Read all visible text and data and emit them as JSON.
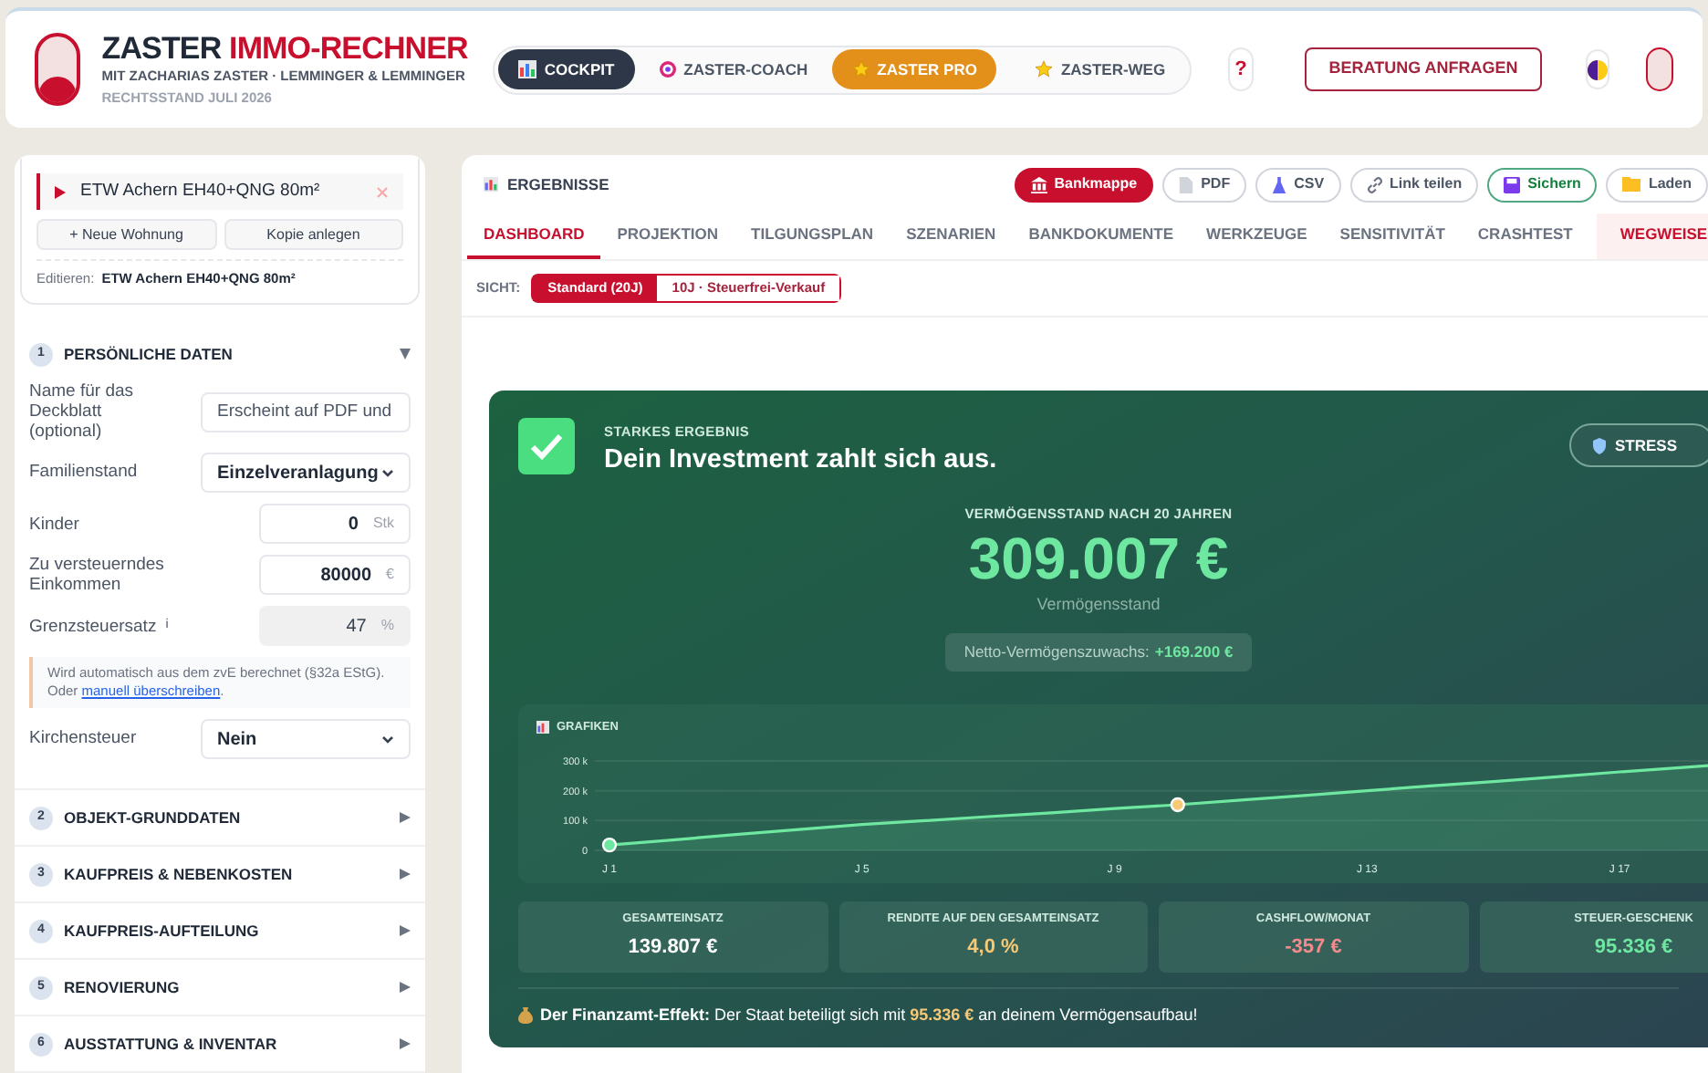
{
  "header": {
    "title": "ZASTER",
    "title_accent": "IMMO-RECHNER",
    "subtitle": "MIT ZACHARIAS ZASTER · LEMMINGER & LEMMINGER",
    "legal": "RECHTSSTAND JULI 2026",
    "nav": [
      {
        "label": "COCKPIT",
        "kind": "dash",
        "selected": true
      },
      {
        "label": "ZASTER-COACH",
        "kind": "coach",
        "selected": false
      },
      {
        "label": "ZASTER PRO",
        "kind": "pro",
        "selected": false
      },
      {
        "label": "ZASTER-WEG",
        "kind": "star",
        "selected": false
      }
    ],
    "help": "?",
    "consult": "BERATUNG ANFRAGEN"
  },
  "sidebar": {
    "property": "ETW Achern EH40+QNG 80m²",
    "new_button": "+ Neue Wohnung",
    "copy_button": "Kopie anlegen",
    "edit_label": "Editieren:",
    "edit_value": "ETW Achern EH40+QNG 80m²",
    "sections": [
      {
        "number": "1",
        "title": "PERSÖNLICHE DATEN",
        "expanded": true,
        "fields": [
          {
            "kind": "text",
            "label": "Name für das Deckblatt (optional)",
            "placeholder": "Erscheint auf PDF und"
          },
          {
            "kind": "select",
            "label": "Familienstand",
            "value": "Einzelveranlagung"
          },
          {
            "kind": "number",
            "label": "Kinder",
            "value": "0",
            "unit": "Stk"
          },
          {
            "kind": "number",
            "label": "Zu versteuerndes Einkommen",
            "value": "80000",
            "unit": "€"
          },
          {
            "kind": "readonly",
            "label": "Grenzsteuersatz",
            "info": "i",
            "value": "47",
            "unit": "%"
          },
          {
            "kind": "note",
            "text": "Wird automatisch aus dem zvE berechnet (§32a EStG). Oder ",
            "link": "manuell überschreiben",
            "tail": "."
          },
          {
            "kind": "select",
            "label": "Kirchensteuer",
            "value": "Nein"
          }
        ]
      },
      {
        "number": "2",
        "title": "OBJEKT-GRUNDDATEN",
        "expanded": false
      },
      {
        "number": "3",
        "title": "KAUFPREIS & NEBENKOSTEN",
        "expanded": false
      },
      {
        "number": "4",
        "title": "KAUFPREIS-AUFTEILUNG",
        "expanded": false
      },
      {
        "number": "5",
        "title": "RENOVIERUNG",
        "expanded": false
      },
      {
        "number": "6",
        "title": "AUSSTATTUNG & INVENTAR",
        "expanded": false
      }
    ]
  },
  "main": {
    "title": "ERGEBNISSE",
    "actions": [
      {
        "label": "Bankmappe",
        "kind": "primary"
      },
      {
        "label": "PDF",
        "kind": "pdf"
      },
      {
        "label": "CSV",
        "kind": "csv"
      },
      {
        "label": "Link teilen",
        "kind": "link"
      },
      {
        "label": "Sichern",
        "kind": "save"
      },
      {
        "label": "Laden",
        "kind": "load"
      }
    ],
    "tabs": [
      {
        "label": "DASHBOARD",
        "selected": true,
        "kind": "tab"
      },
      {
        "label": "PROJEKTION",
        "selected": false,
        "kind": "tab"
      },
      {
        "label": "TILGUNGSPLAN",
        "selected": false,
        "kind": "tab"
      },
      {
        "label": "SZENARIEN",
        "selected": false,
        "kind": "tab"
      },
      {
        "label": "BANKDOKUMENTE",
        "selected": false,
        "kind": "tab"
      },
      {
        "label": "WERKZEUGE",
        "selected": false,
        "kind": "tab"
      },
      {
        "label": "SENSITIVITÄT",
        "selected": false,
        "kind": "tab"
      },
      {
        "label": "CRASHTEST",
        "selected": false,
        "kind": "tab"
      },
      {
        "label": "WEGWEISE",
        "selected": false,
        "kind": "guide"
      }
    ],
    "view_label": "SICHT:",
    "views": [
      {
        "label": "Standard (20J)",
        "selected": true
      },
      {
        "label": "10J · Steuerfrei-Verkauf",
        "selected": false
      }
    ],
    "result": {
      "eyebrow": "STARKES ERGEBNIS",
      "headline": "Dein Investment zahlt sich aus.",
      "stress_button": "STRESS",
      "wealth_label": "VERMÖGENSSTAND NACH 20 JAHREN",
      "wealth_value": "309.007 €",
      "wealth_caption": "Vermögensstand",
      "net_label": "Netto-Vermögenszuwachs:",
      "net_value": "+169.200 €",
      "chart_title": "GRAFIKEN",
      "chart_data": {
        "type": "area",
        "categories": [
          "J 1",
          null,
          null,
          null,
          "J 5",
          null,
          null,
          null,
          "J 9",
          null,
          null,
          null,
          "J 13",
          null,
          null,
          null,
          "J 17",
          null,
          null,
          null
        ],
        "yticks": [
          {
            "value": 0,
            "label": "0"
          },
          {
            "value": 100000,
            "label": "100 k"
          },
          {
            "value": 200000,
            "label": "200 k"
          },
          {
            "value": 300000,
            "label": "300 k"
          }
        ],
        "ylim": [
          0,
          300000
        ],
        "series": [
          {
            "color": "#6ee7a0",
            "values": [
              18000,
              35000,
              53000,
              70000,
              87000,
              100000,
              113000,
              126000,
              140000,
              153000,
              169000,
              184000,
              200000,
              216000,
              231000,
              247000,
              263000,
              278000,
              294000,
              null
            ]
          }
        ]
      },
      "kpis": [
        {
          "label": "GESAMTEINSATZ",
          "value": "139.807 €",
          "color": "#ffffff"
        },
        {
          "label": "RENDITE AUF DEN GESAMTEINSATZ",
          "value": "4,0 %",
          "color": "#f6c977"
        },
        {
          "label": "CASHFLOW/MONAT",
          "value": "-357 €",
          "color": "#f28b8b"
        },
        {
          "label": "STEUER-GESCHENK",
          "value": "95.336 €",
          "color": "#6ee7a0"
        }
      ],
      "footer": {
        "lead": "Der Finanzamt-Effekt:",
        "text": "Der Staat beteiligt sich mit",
        "amount": "95.336 €",
        "tail": "an deinem Vermögensaufbau!"
      }
    }
  }
}
